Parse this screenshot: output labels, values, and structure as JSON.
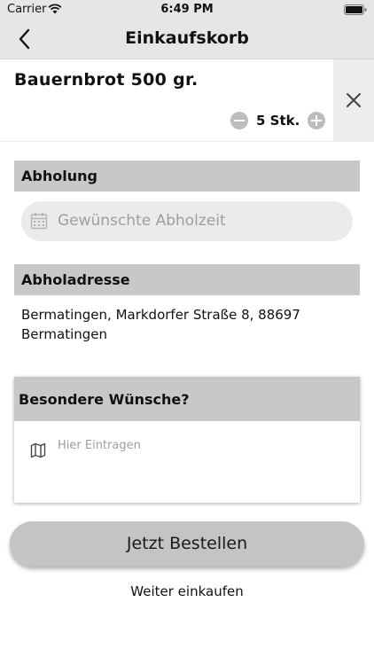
{
  "status_bar": {
    "carrier": "Carrier",
    "time": "6:49 PM"
  },
  "nav": {
    "title": "Einkaufskorb",
    "back_icon": "chevron-left-icon"
  },
  "cart_item": {
    "name": "Bauernbrot 500 gr.",
    "quantity_label": "5 Stk.",
    "decrement_icon": "minus-circle-icon",
    "increment_icon": "plus-circle-icon",
    "remove_icon": "close-icon"
  },
  "pickup": {
    "header": "Abholung",
    "placeholder": "Gewünschte Abholzeit",
    "icon": "calendar-icon"
  },
  "address": {
    "header": "Abholadresse",
    "text": "Bermatingen, Markdorfer Straße 8, 88697 Bermatingen"
  },
  "wishes": {
    "header": "Besondere Wünsche?",
    "placeholder": "Hier Eintragen",
    "icon": "map-icon"
  },
  "actions": {
    "order_label": "Jetzt Bestellen",
    "continue_label": "Weiter einkaufen"
  },
  "colors": {
    "bar_background": "#e6e6e6",
    "section_header": "#c8c8c8",
    "field_background": "#ebebeb",
    "button_background": "#c4c4c4",
    "placeholder_text": "#9e9e9e"
  }
}
